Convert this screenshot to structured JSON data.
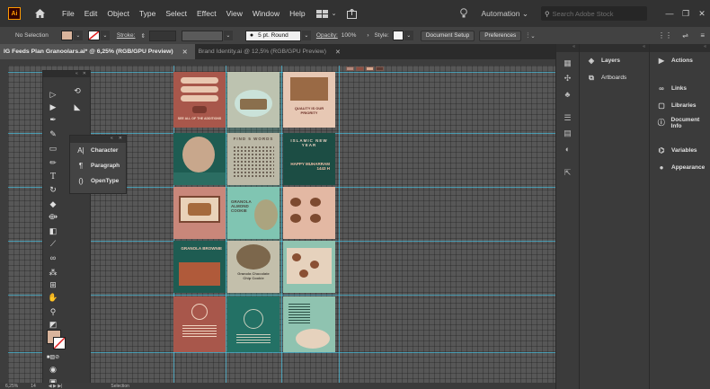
{
  "app": {
    "logo_text": "Ai"
  },
  "menu": [
    "File",
    "Edit",
    "Object",
    "Type",
    "Select",
    "Effect",
    "View",
    "Window",
    "Help"
  ],
  "topbar": {
    "workspace": "Automation",
    "search_placeholder": "Search Adobe Stock"
  },
  "control": {
    "selection": "No Selection",
    "stroke_label": "Stroke:",
    "brush": "5 pt. Round",
    "opacity_label": "Opacity:",
    "opacity_value": "100%",
    "style_label": "Style:",
    "document_setup": "Document Setup",
    "preferences": "Preferences"
  },
  "tabs": [
    {
      "label": "IG Feeds Plan Granoolars.ai* @ 6,25% (RGB/GPU Preview)",
      "active": true
    },
    {
      "label": "Brand Identity.ai @ 12,5% (RGB/GPU Preview)",
      "active": false
    }
  ],
  "artboard_tiles": {
    "t1": "SEE ALL OF THE ADDITIONS",
    "t4": "QUALITY IS OUR PRIORITY",
    "t5": "FIND 5 WORDS",
    "t6": "ISLAMIC NEW YEAR",
    "t6b": "HAPPY MUHARRAM 1443 H",
    "t8": "GRANOLA ALMOND COOKIE",
    "t10": "GRANOLA BROWNIE",
    "t11": "Granola Chocolate Chip Cookie"
  },
  "character_panel": {
    "items": [
      "Character",
      "Paragraph",
      "OpenType"
    ]
  },
  "dock": {
    "panel1": [
      "Layers",
      "Artboards"
    ],
    "panel2": [
      "Actions",
      "Links",
      "Libraries",
      "Document Info",
      "Variables",
      "Appearance"
    ]
  },
  "status": {
    "zoom": "6,25%",
    "artboard_index": "14",
    "mode": "Selection"
  },
  "colors": {
    "accent": "#3fd7ff",
    "brand_orange": "#ff9a00",
    "tile_rose": "#c98576",
    "tile_green": "#1f5b4f",
    "tile_cream": "#e8c9b5"
  }
}
